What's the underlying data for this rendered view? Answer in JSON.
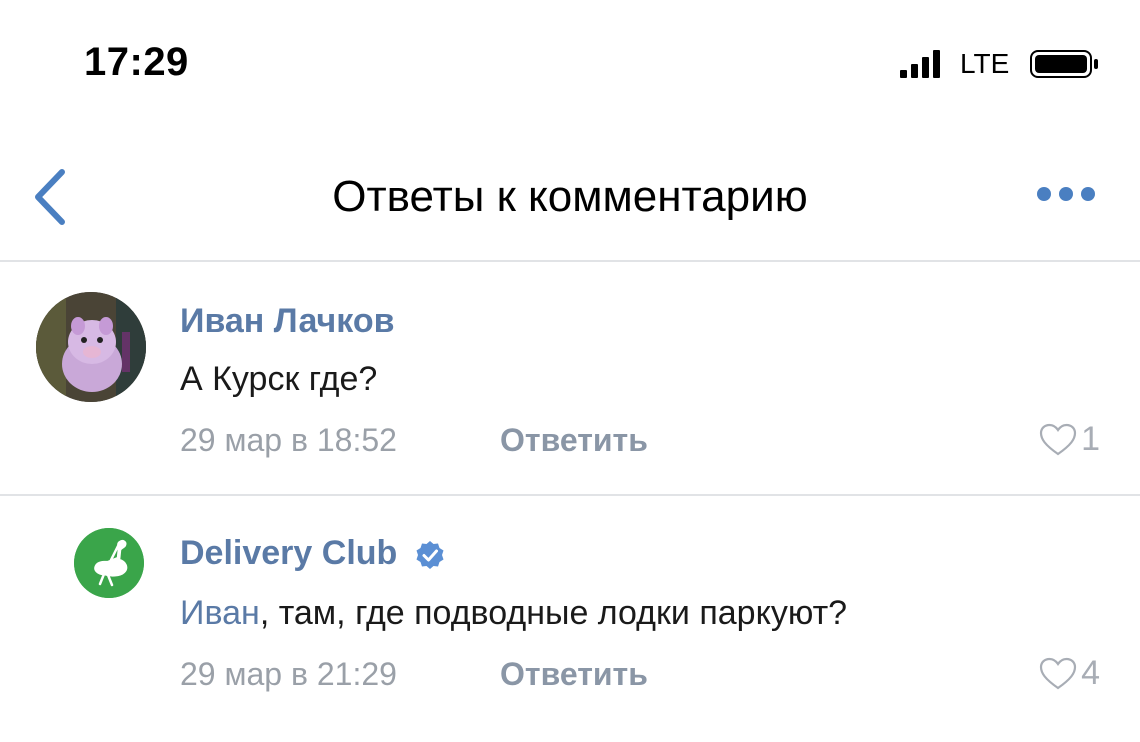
{
  "status_bar": {
    "time": "17:29",
    "network": "LTE"
  },
  "nav": {
    "title": "Ответы к комментарию"
  },
  "comments": [
    {
      "author": "Иван Лачков",
      "text": "А Курск где?",
      "date": "29 мар в 18:52",
      "reply_label": "Ответить",
      "likes": "1",
      "avatar_icon": "cartoon-pig-avatar"
    },
    {
      "author": "Delivery Club",
      "verified": true,
      "mention": "Иван",
      "text": ", там, где подводные лодки паркуют?",
      "date": "29 мар в 21:29",
      "reply_label": "Ответить",
      "likes": "4",
      "avatar_icon": "ostrich-logo"
    }
  ],
  "colors": {
    "link": "#5a7aa6",
    "accent": "#4a7fc1",
    "brand_green": "#3aa54a",
    "muted": "#9aa0a8"
  }
}
